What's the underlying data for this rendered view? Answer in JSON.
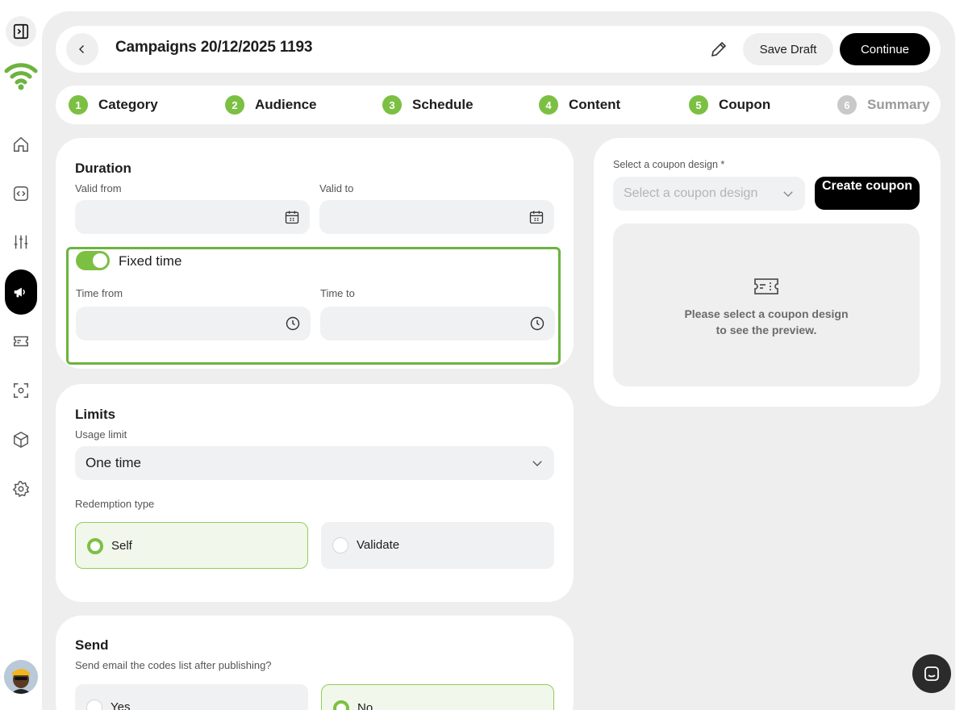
{
  "header": {
    "title": "Campaigns 20/12/2025 1193",
    "save_draft_label": "Save Draft",
    "continue_label": "Continue"
  },
  "steps": [
    {
      "num": "1",
      "label": "Category",
      "state": "done"
    },
    {
      "num": "2",
      "label": "Audience",
      "state": "done"
    },
    {
      "num": "3",
      "label": "Schedule",
      "state": "done"
    },
    {
      "num": "4",
      "label": "Content",
      "state": "done"
    },
    {
      "num": "5",
      "label": "Coupon",
      "state": "current"
    },
    {
      "num": "6",
      "label": "Summary",
      "state": "upcoming"
    }
  ],
  "duration": {
    "title": "Duration",
    "valid_from_label": "Valid from",
    "valid_to_label": "Valid to",
    "valid_from_value": "",
    "valid_to_value": "",
    "fixed_time_label": "Fixed time",
    "fixed_time_on": true,
    "time_from_label": "Time from",
    "time_to_label": "Time to",
    "time_from_value": "",
    "time_to_value": ""
  },
  "limits": {
    "title": "Limits",
    "usage_limit_label": "Usage limit",
    "usage_limit_value": "One time",
    "redemption_type_label": "Redemption type",
    "redemption_options": [
      {
        "label": "Self",
        "selected": true
      },
      {
        "label": "Validate",
        "selected": false
      }
    ]
  },
  "send": {
    "title": "Send",
    "question": "Send email the codes list after publishing?",
    "options": [
      {
        "label": "Yes",
        "selected": false
      },
      {
        "label": "No",
        "selected": true
      }
    ]
  },
  "coupon": {
    "select_label": "Select a coupon design *",
    "select_placeholder": "Select a coupon design",
    "create_button_label": "Create coupon",
    "preview_line1": "Please select a coupon design",
    "preview_line2": "to see the preview."
  },
  "colors": {
    "accent_green": "#7cc043",
    "primary_black": "#000000",
    "panel_bg": "#eeeeee"
  },
  "icons": {
    "sidebar": [
      "sidebar-toggle-icon",
      "wifi-logo-icon",
      "home-icon",
      "code-icon",
      "sliders-icon",
      "megaphone-icon",
      "ticket-icon",
      "scan-icon",
      "cube-icon",
      "gear-icon"
    ],
    "chat": "chat-icon"
  }
}
